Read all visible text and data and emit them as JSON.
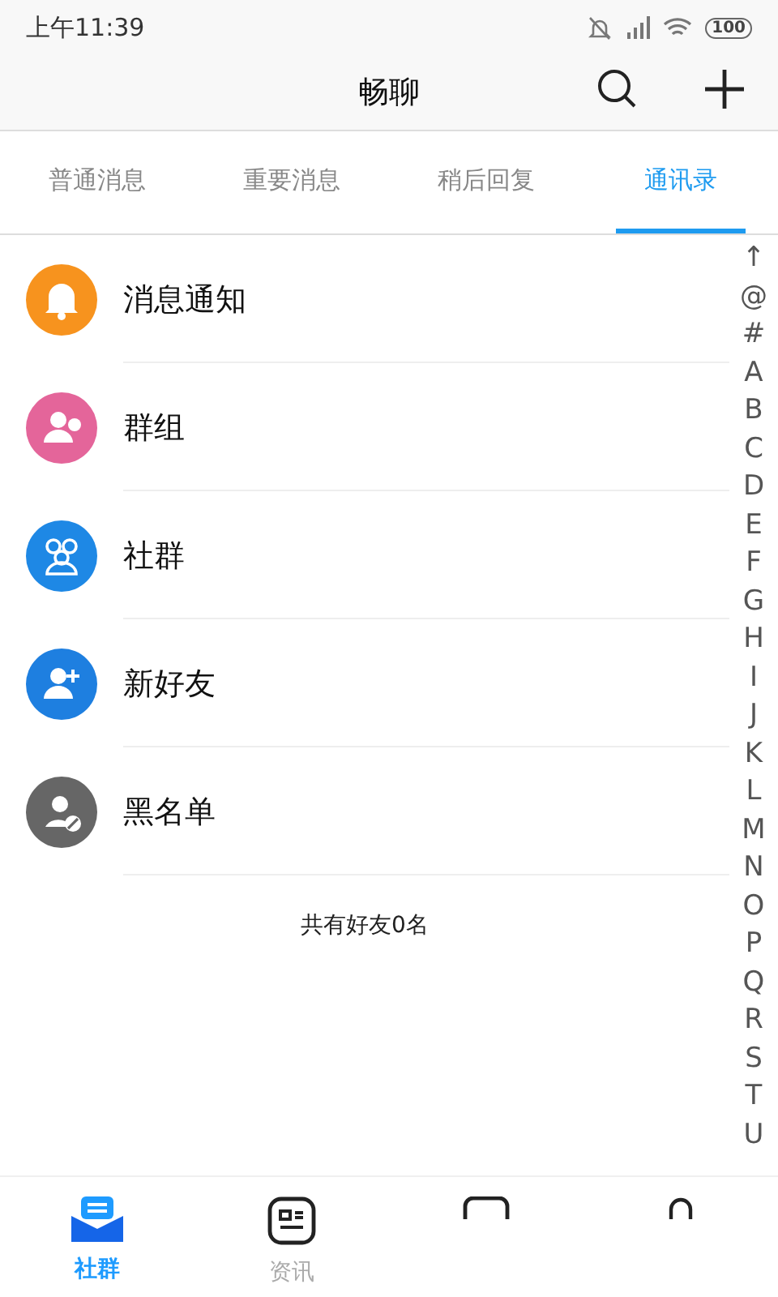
{
  "status_bar": {
    "time": "上午11:39",
    "battery": "100"
  },
  "header": {
    "title": "畅聊"
  },
  "tabs": [
    {
      "label": "普通消息",
      "selected": false
    },
    {
      "label": "重要消息",
      "selected": false
    },
    {
      "label": "稍后回复",
      "selected": false
    },
    {
      "label": "通讯录",
      "selected": true
    }
  ],
  "contacts": [
    {
      "kind": "bell",
      "label": "消息通知",
      "color": "#f7931e"
    },
    {
      "kind": "group",
      "label": "群组",
      "color": "#e4659a"
    },
    {
      "kind": "community",
      "label": "社群",
      "color": "#1e88e5"
    },
    {
      "kind": "add-friend",
      "label": "新好友",
      "color": "#1e7fe0"
    },
    {
      "kind": "blacklist",
      "label": "黑名单",
      "color": "#666666"
    }
  ],
  "friend_count": "共有好友0名",
  "index_letters": [
    "↑",
    "@",
    "#",
    "A",
    "B",
    "C",
    "D",
    "E",
    "F",
    "G",
    "H",
    "I",
    "J",
    "K",
    "L",
    "M",
    "N",
    "O",
    "P",
    "Q",
    "R",
    "S",
    "T",
    "U"
  ],
  "bottom_nav": [
    {
      "kind": "community",
      "label": "社群",
      "selected": true
    },
    {
      "kind": "news",
      "label": "资讯",
      "selected": false
    },
    {
      "kind": "game",
      "selected": false
    },
    {
      "kind": "me",
      "selected": false
    }
  ]
}
